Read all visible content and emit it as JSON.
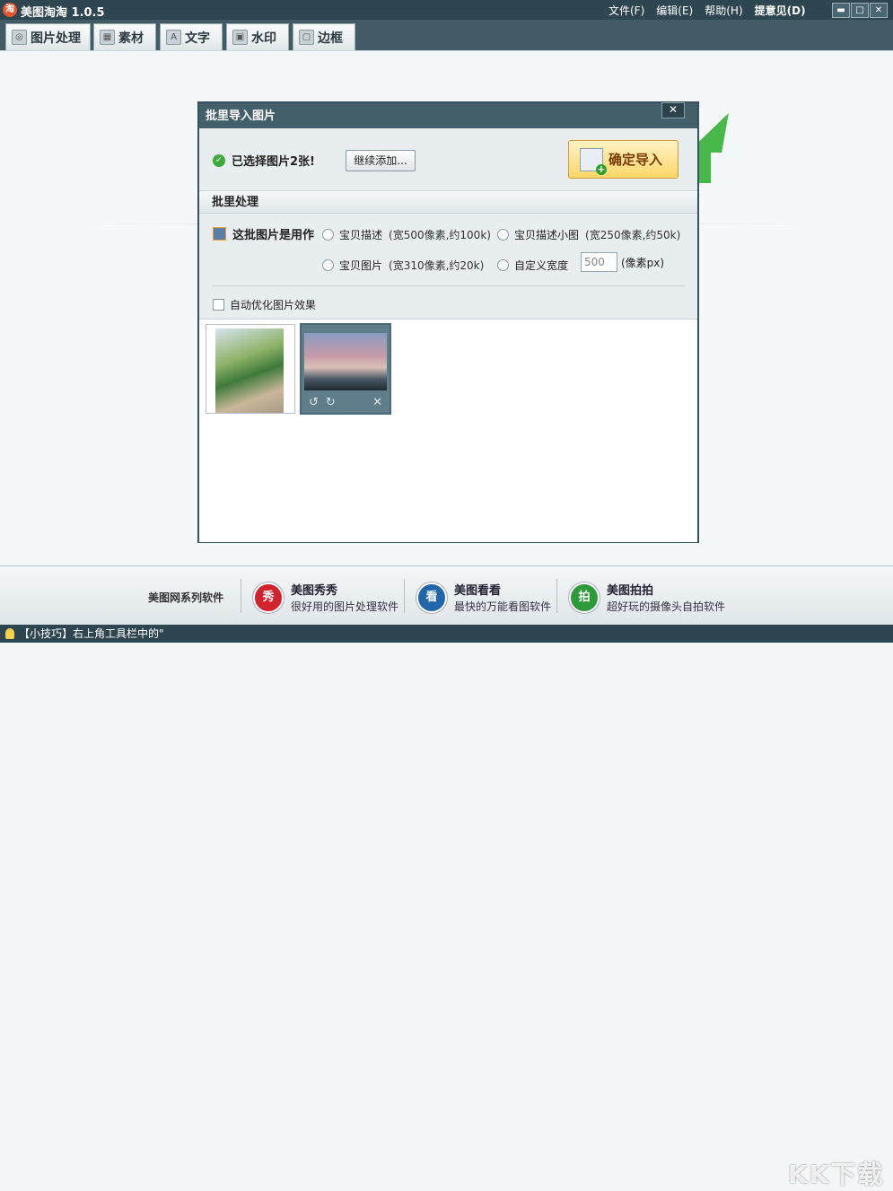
{
  "app": {
    "title": "美图淘淘 1.0.5",
    "logo_glyph": "淘"
  },
  "menu": [
    {
      "label": "文件(F)"
    },
    {
      "label": "编辑(E)"
    },
    {
      "label": "帮助(H)"
    },
    {
      "label": "提意见(D)"
    }
  ],
  "window_controls": {
    "minimize": "▬",
    "maximize": "□",
    "close": "✕"
  },
  "tabs": [
    {
      "label": "图片处理",
      "icon": "image-process-icon",
      "glyph": "◎"
    },
    {
      "label": "素材",
      "icon": "material-icon",
      "glyph": "▦"
    },
    {
      "label": "文字",
      "icon": "text-icon",
      "glyph": "A"
    },
    {
      "label": "水印",
      "icon": "watermark-icon",
      "glyph": "▣"
    },
    {
      "label": "边框",
      "icon": "border-icon",
      "glyph": "▢"
    }
  ],
  "dialog": {
    "title": "批里导入图片",
    "close_glyph": "✕",
    "selected_text": "已选择图片2张!",
    "add_button": "继续添加...",
    "import_button": "确定导入",
    "section_title": "批里处理",
    "usage_label": "这批图片是用作",
    "options": [
      {
        "label": "宝贝描述",
        "hint": "(宽500像素,约100k)"
      },
      {
        "label": "宝贝描述小图",
        "hint": "(宽250像素,约50k)"
      },
      {
        "label": "宝贝图片",
        "hint": "(宽310像素,约20k)"
      },
      {
        "label": "自定义宽度",
        "hint": ""
      }
    ],
    "custom_width_value": "500",
    "unit_label": "(像素px)",
    "auto_optimize": "自动优化图片效果",
    "thumb_tools": {
      "rotate_left": "↺",
      "rotate_right": "↻",
      "delete": "✕"
    }
  },
  "bottom": {
    "series_label": "美图网系列软件",
    "products": [
      {
        "name": "美图秀秀",
        "desc": "很好用的图片处理软件",
        "glyph": "秀",
        "color": "#d0232e"
      },
      {
        "name": "美图看看",
        "desc": "最快的万能看图软件",
        "glyph": "看",
        "color": "#2266aa"
      },
      {
        "name": "美图拍拍",
        "desc": "超好玩的摄像头自拍软件",
        "glyph": "拍",
        "color": "#2f9a3a"
      }
    ]
  },
  "status": {
    "tip": "【小技巧】右上角工具栏中的\""
  },
  "watermark": "KK下载",
  "colors": {
    "titlebar": "#2d4650",
    "accent_green": "#49b84a",
    "import_button": "#ffd76a"
  }
}
